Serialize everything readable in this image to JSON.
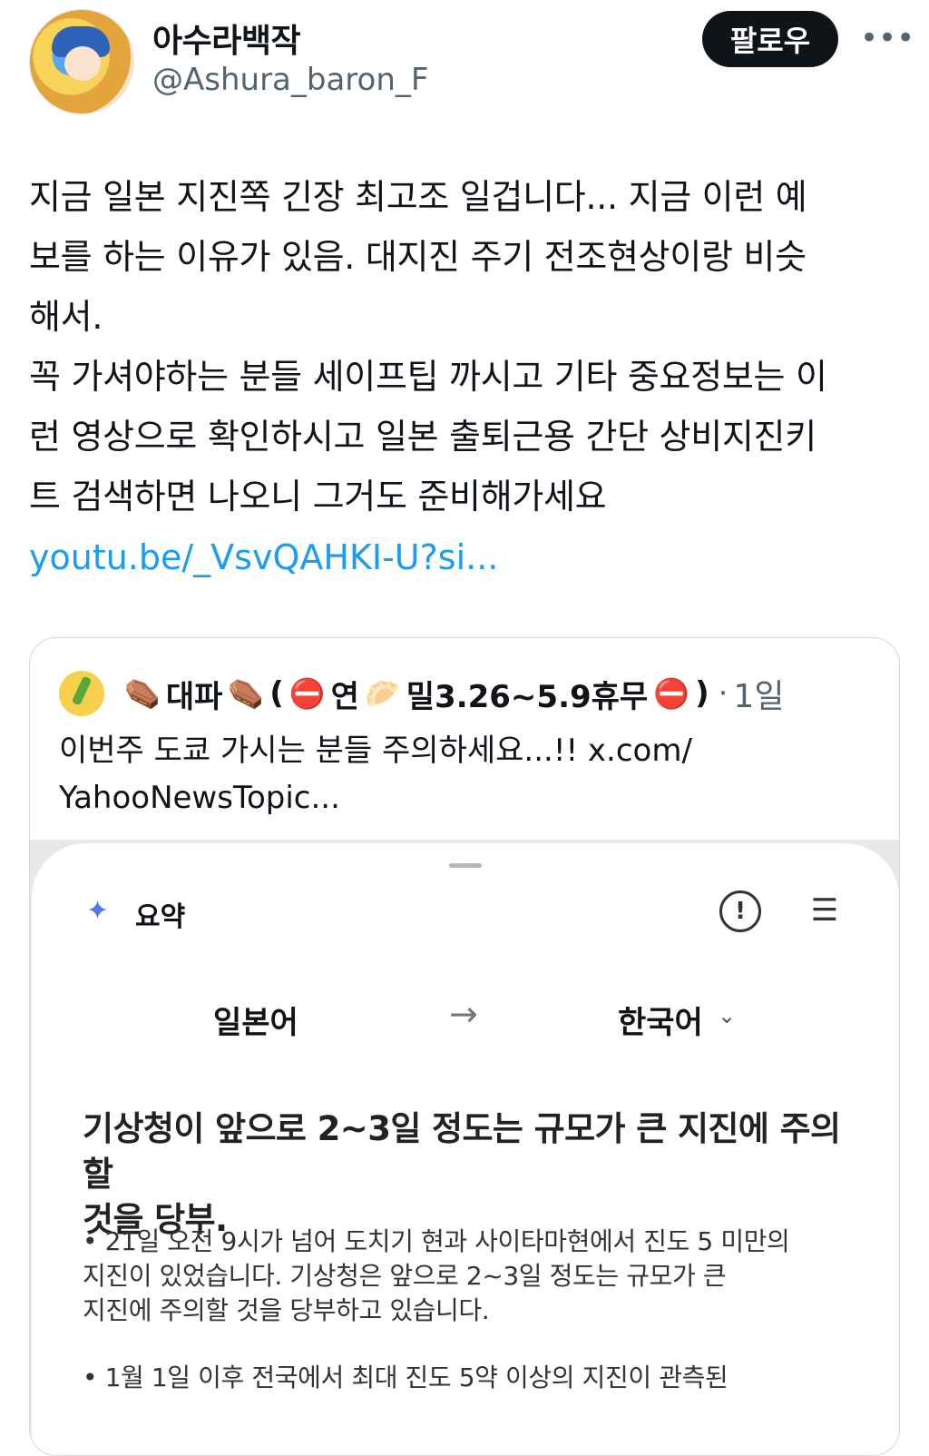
{
  "author": {
    "display_name": "아수라백작",
    "handle": "@Ashura_baron_F",
    "follow_label": "팔로우",
    "more_icon": "more-icon"
  },
  "tweet": {
    "lines": [
      "지금 일본 지진쪽 긴장 최고조 일겁니다... 지금 이런 예",
      "보를 하는 이유가 있음. 대지진 주기 전조현상이랑 비슷",
      "해서.",
      "꼭 가셔야하는 분들 세이프팁 까시고 기타 중요정보는 이",
      "런 영상으로 확인하시고 일본 출퇴근용 간단 상비지진키",
      "트 검색하면 나오니 그거도 준비해가세요"
    ],
    "link": "youtu.be/_VsvQAHKI-U?si...",
    "link_color": "#1d9bf0"
  },
  "quote": {
    "emoji_1": "⚰️",
    "name_part_1": "대파",
    "emoji_2": "⚰️",
    "paren_open": "(",
    "emoji_3": "⛔",
    "name_part_2": "연",
    "emoji_4": "🥟",
    "name_part_3": "밀3.26~5.9휴무",
    "emoji_5": "⛔",
    "paren_close": ")",
    "separator": "·",
    "time": "1일",
    "text_line1": "이번주 도쿄 가시는 분들 주의하세요...!! x.com/",
    "text_line2": "YahooNewsTopic..."
  },
  "summary_card": {
    "title": "요약",
    "from_lang": "일본어",
    "arrow": "→",
    "to_lang": "한국어",
    "chevron": "⌄",
    "headline_line1": "기상청이 앞으로 2~3일 정도는 규모가 큰 지진에 주의할",
    "headline_line2": "것을 당부.",
    "bullet1_line1": "• 21일 오전 9시가 넘어 도치기 현과 사이타마현에서 진도 5 미만의",
    "bullet1_line2": "지진이 있었습니다. 기상청은 앞으로 2~3일 정도는 규모가 큰",
    "bullet1_line3": "지진에 주의할 것을 당부하고 있습니다.",
    "bullet2_line1": "• 1월 1일 이후 전국에서 최대 진도 5약 이상의 지진이 관측된"
  }
}
